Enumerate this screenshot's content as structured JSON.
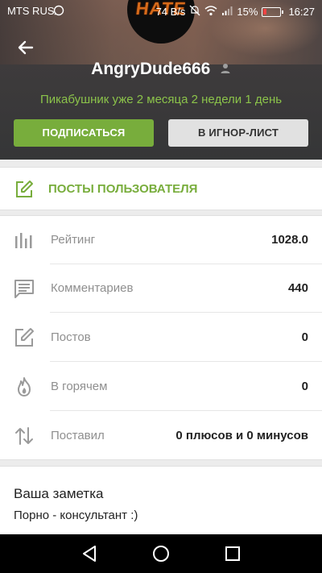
{
  "status_bar": {
    "carrier": "MTS RUS",
    "network_speed": "74 B/s",
    "battery": "15%",
    "time": "16:27"
  },
  "profile": {
    "avatar_text": "HATE",
    "username": "AngryDude666",
    "member_since": "Пикабушник уже 2 месяца 2 недели 1 день",
    "subscribe_label": "ПОДПИСАТЬСЯ",
    "ignore_label": "В ИГНОР-ЛИСТ"
  },
  "posts_link": {
    "label": "ПОСТЫ ПОЛЬЗОВАТЕЛЯ"
  },
  "stats": [
    {
      "icon": "bar-chart-icon",
      "label": "Рейтинг",
      "value": "1028.0"
    },
    {
      "icon": "comment-icon",
      "label": "Комментариев",
      "value": "440"
    },
    {
      "icon": "edit-icon",
      "label": "Постов",
      "value": "0"
    },
    {
      "icon": "flame-icon",
      "label": "В горячем",
      "value": "0"
    },
    {
      "icon": "sort-arrows-icon",
      "label": "Поставил",
      "value": "0 плюсов и 0 минусов"
    }
  ],
  "note": {
    "title": "Ваша заметка",
    "text": "Порно - консультант :)"
  },
  "colors": {
    "accent_green": "#78ad3c",
    "member_since_green": "#8bc34a",
    "header_dark": "#353637"
  }
}
